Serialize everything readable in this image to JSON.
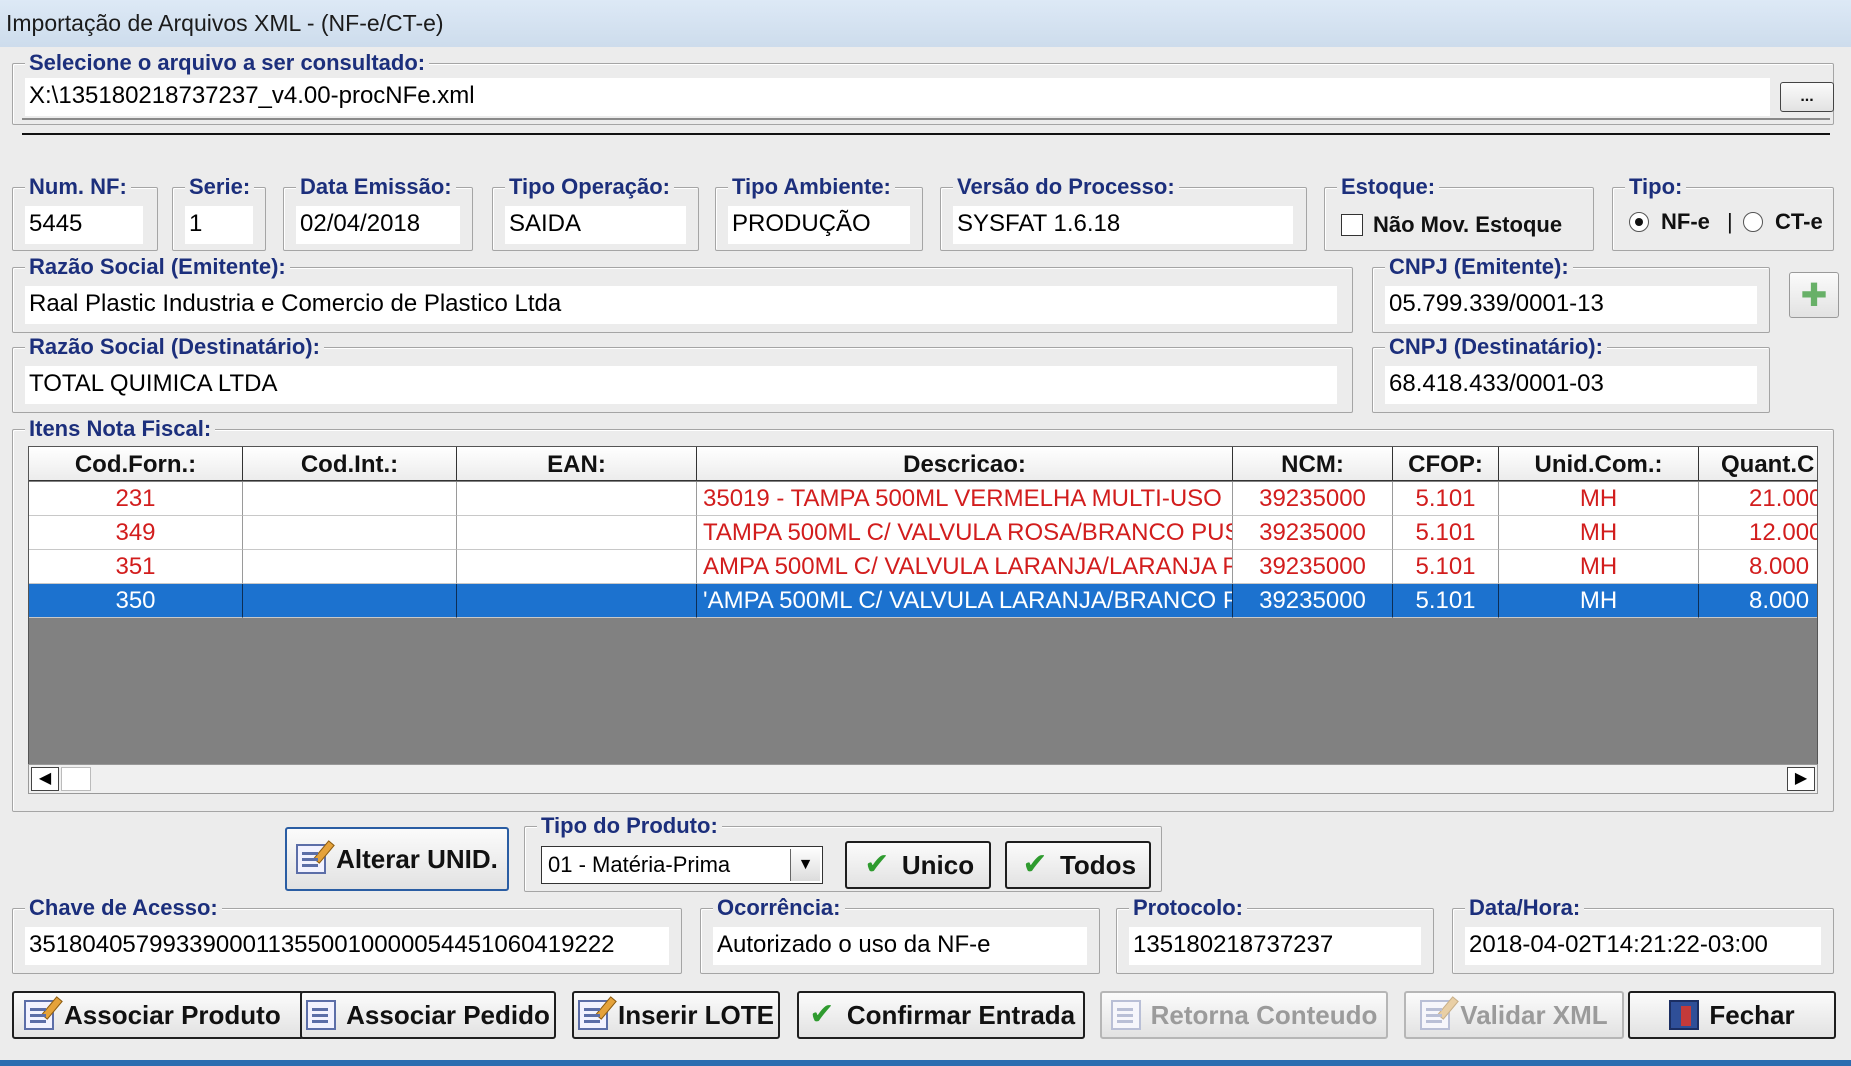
{
  "window": {
    "title": "Importação de Arquivos XML - (NF-e/CT-e)"
  },
  "file_select": {
    "legend": "Selecione o arquivo a ser consultado:",
    "path": "X:\\135180218737237_v4.00-procNFe.xml",
    "browse_label": "..."
  },
  "nf": {
    "num_legend": "Num. NF:",
    "num": "5445",
    "serie_legend": "Serie:",
    "serie": "1",
    "data_legend": "Data Emissão:",
    "data": "02/04/2018",
    "tipo_op_legend": "Tipo Operação:",
    "tipo_op": "SAIDA",
    "ambiente_legend": "Tipo Ambiente:",
    "ambiente": "PRODUÇÃO",
    "versao_legend": "Versão do Processo:",
    "versao": "SYSFAT 1.6.18",
    "estoque_legend": "Estoque:",
    "estoque_check_label": "Não Mov. Estoque",
    "tipo_legend": "Tipo:",
    "tipo_nfe": "NF-e",
    "tipo_sep": "|",
    "tipo_cte": "CT-e"
  },
  "emitente": {
    "razao_legend": "Razão Social (Emitente):",
    "razao": "Raal Plastic Industria e Comercio de Plastico Ltda",
    "cnpj_legend": "CNPJ (Emitente):",
    "cnpj": "05.799.339/0001-13"
  },
  "destinatario": {
    "razao_legend": "Razão Social (Destinatário):",
    "razao": "TOTAL QUIMICA LTDA",
    "cnpj_legend": "CNPJ (Destinatário):",
    "cnpj": "68.418.433/0001-03"
  },
  "itens": {
    "legend": "Itens Nota Fiscal:",
    "columns": [
      "Cod.Forn.:",
      "Cod.Int.:",
      "EAN:",
      "Descricao:",
      "NCM:",
      "CFOP:",
      "Unid.Com.:",
      "Quant.C"
    ],
    "rows": [
      [
        "231",
        "",
        "",
        "35019 - TAMPA 500ML VERMELHA MULTI-USO",
        "39235000",
        "5.101",
        "MH",
        "21.000"
      ],
      [
        "349",
        "",
        "",
        " TAMPA 500ML C/ VALVULA ROSA/BRANCO PUS",
        "39235000",
        "5.101",
        "MH",
        "12.000"
      ],
      [
        "351",
        "",
        "",
        "AMPA 500ML C/ VALVULA LARANJA/LARANJA P",
        "39235000",
        "5.101",
        "MH",
        "8.000"
      ],
      [
        "350",
        "",
        "",
        "'AMPA 500ML C/ VALVULA LARANJA/BRANCO P",
        "39235000",
        "5.101",
        "MH",
        "8.000"
      ]
    ],
    "selected_row": 3,
    "scroll_left": "◀",
    "scroll_right": "▶"
  },
  "produto": {
    "alterar_label": "Alterar UNID.",
    "tipo_legend": "Tipo do Produto:",
    "tipo_value": "01 - Matéria-Prima",
    "unico_label": "Unico",
    "todos_label": "Todos"
  },
  "acesso": {
    "chave_legend": "Chave de Acesso:",
    "chave": "35180405799339000113550010000054451060419222",
    "ocorrencia_legend": "Ocorrência:",
    "ocorrencia": "Autorizado o uso da NF-e",
    "protocolo_legend": "Protocolo:",
    "protocolo": "135180218737237",
    "datahora_legend": "Data/Hora:",
    "datahora": "2018-04-02T14:21:22-03:00"
  },
  "actions": {
    "associar_produto": "Associar Produto",
    "associar_pedido": "Associar Pedido",
    "inserir_lote": "Inserir LOTE",
    "confirmar_entrada": "Confirmar Entrada",
    "retorna_conteudo": "Retorna Conteudo",
    "validar_xml": "Validar XML",
    "fechar": "Fechar"
  },
  "colors": {
    "legend": "#1c2f7c",
    "row_text": "#d21d1d",
    "selection": "#1c72cf",
    "grid_bg": "#818181"
  }
}
